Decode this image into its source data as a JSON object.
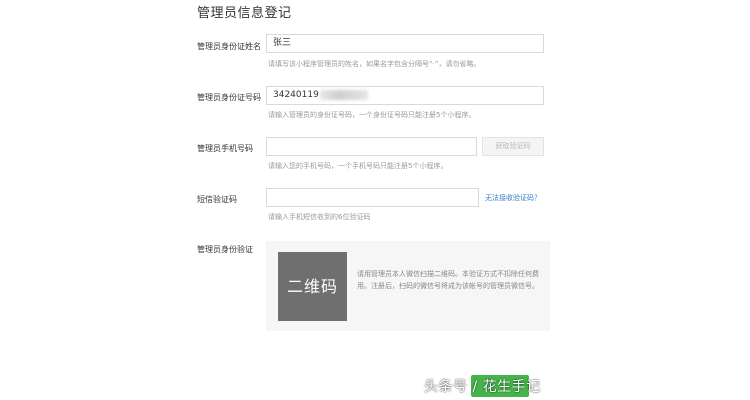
{
  "form": {
    "title": "管理员信息登记",
    "name": {
      "label": "管理员身份证姓名",
      "value": "张三",
      "hint": "请填写该小程序管理员的姓名，如果名字包含分隔号“·”，请勿省略。"
    },
    "id_number": {
      "label": "管理员身份证号码",
      "value_visible": "34240119",
      "hint": "请输入管理员的身份证号码，一个身份证号码只能注册5个小程序。"
    },
    "phone": {
      "label": "管理员手机号码",
      "value": "",
      "button": "获取验证码",
      "hint": "请输入您的手机号码，一个手机号码只能注册5个小程序。"
    },
    "sms": {
      "label": "短信验证码",
      "value": "",
      "link": "无法接收验证码？",
      "hint": "请输入手机短信收到的6位验证码"
    },
    "identity_verify": {
      "label": "管理员身份验证",
      "qr_label": "二维码",
      "description": "请用管理员本人微信扫描二维码。本验证方式不扣除任何费用。注册后，扫码的微信号将成为该帐号的管理员微信号。"
    }
  },
  "watermark": "头条号 / 花生手记",
  "colors": {
    "primary_green": "#44b549",
    "link_blue": "#3a7ec9",
    "hint_gray": "#999999",
    "qr_gray": "#6f6f6f"
  }
}
